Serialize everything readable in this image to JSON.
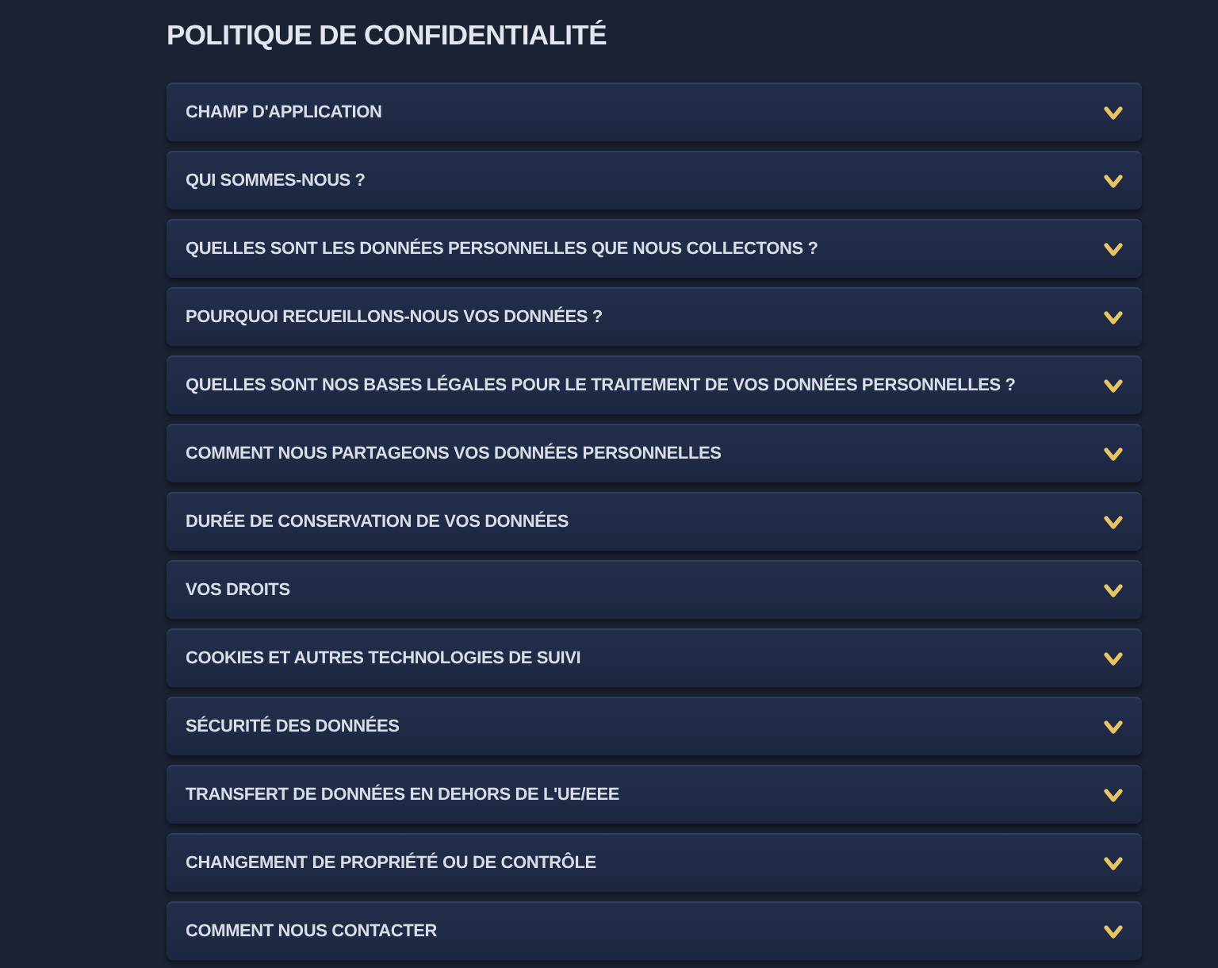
{
  "page": {
    "title": "POLITIQUE DE CONFIDENTIALITÉ"
  },
  "sections": [
    {
      "label": "CHAMP D'APPLICATION",
      "expanded": false
    },
    {
      "label": "QUI SOMMES-NOUS ?",
      "expanded": false
    },
    {
      "label": "QUELLES SONT LES DONNÉES PERSONNELLES QUE NOUS COLLECTONS ?",
      "expanded": false
    },
    {
      "label": "POURQUOI RECUEILLONS-NOUS VOS DONNÉES ?",
      "expanded": false
    },
    {
      "label": "QUELLES SONT NOS BASES LÉGALES POUR LE TRAITEMENT DE VOS DONNÉES PERSONNELLES ?",
      "expanded": false
    },
    {
      "label": "COMMENT NOUS PARTAGEONS VOS DONNÉES PERSONNELLES",
      "expanded": false
    },
    {
      "label": "DURÉE DE CONSERVATION DE VOS DONNÉES",
      "expanded": false
    },
    {
      "label": "VOS DROITS",
      "expanded": false
    },
    {
      "label": "COOKIES ET AUTRES TECHNOLOGIES DE SUIVI",
      "expanded": false
    },
    {
      "label": "SÉCURITÉ DES DONNÉES",
      "expanded": false
    },
    {
      "label": "TRANSFERT DE DONNÉES EN DEHORS DE L'UE/EEE",
      "expanded": false
    },
    {
      "label": "CHANGEMENT DE PROPRIÉTÉ OU DE CONTRÔLE",
      "expanded": false
    },
    {
      "label": "COMMENT NOUS CONTACTER",
      "expanded": false
    }
  ]
}
